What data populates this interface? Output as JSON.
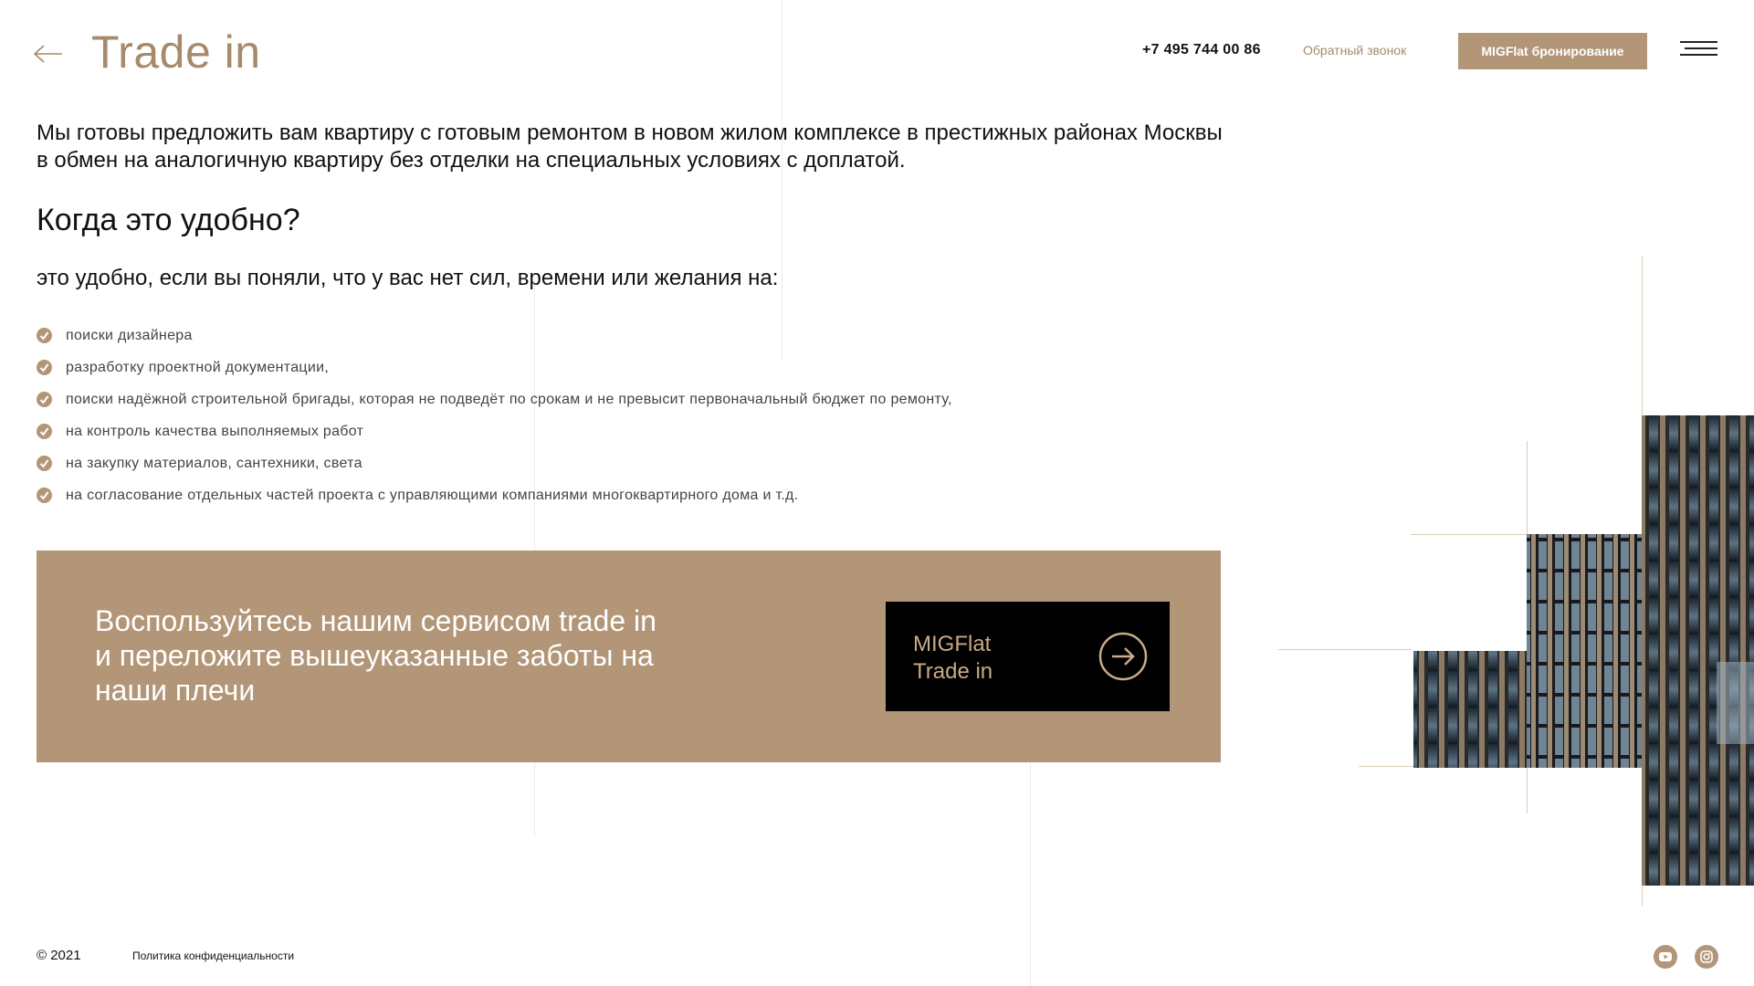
{
  "header": {
    "title": "Trade in",
    "phone": "+7 495 744 00 86",
    "callback_label": "Обратный звонок",
    "booking_label": "MIGFlat бронирование"
  },
  "main": {
    "intro": "Мы готовы предложить вам квартиру с готовым ремонтом в новом жилом комплексе в престижных районах Москвы в обмен на аналогичную квартиру без отделки на специальных условиях с доплатой.",
    "heading": "Когда это удобно?",
    "subheading": "это удобно, если вы поняли, что у вас нет сил, времени или желания на:",
    "checklist": [
      "поиски дизайнера",
      "разработку проектной документации,",
      "поиски надёжной строительной бригады, которая не подведёт по срокам и не превысит первоначальный бюджет по ремонту,",
      "на контроль качества выполняемых работ",
      "на закупку материалов, сантехники, света",
      "на согласование отдельных частей проекта с управляющими компаниями многоквартирного дома и т.д."
    ]
  },
  "promo": {
    "text": "Воспользуйтесь нашим сервисом trade in и переложите вышеуказанные заботы на наши плечи",
    "button_label": "MIGFlat\nTrade in"
  },
  "footer": {
    "copyright": "© 2021",
    "privacy_label": "Политика конфиденциальности",
    "social": [
      "youtube-icon",
      "instagram-icon"
    ]
  },
  "colors": {
    "accent": "#b29677",
    "title": "#a68a6b",
    "promo_button": "#000000",
    "promo_button_text": "#c9ab86"
  }
}
